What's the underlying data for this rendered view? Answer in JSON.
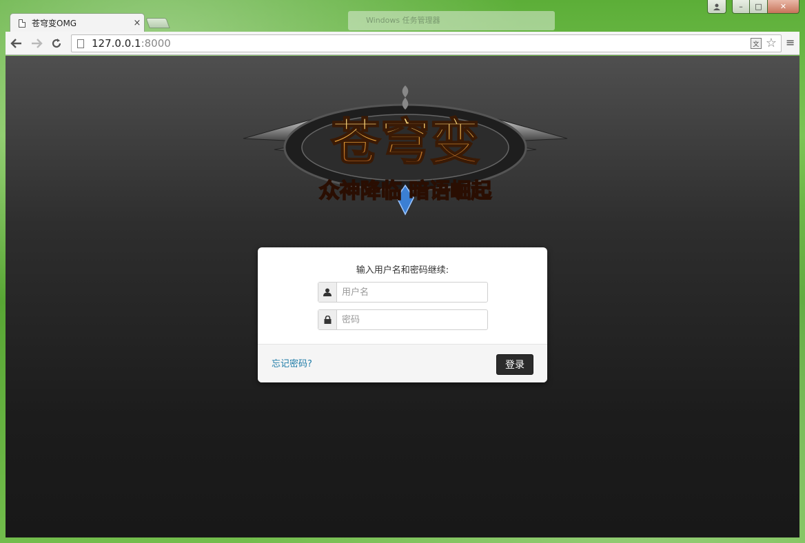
{
  "browser": {
    "tab_title": "苍穹变OMG",
    "url_host": "127.0.0.1",
    "url_port": ":8000",
    "background_window_title": "Windows 任务管理器"
  },
  "window_controls": {
    "minimize": "–",
    "maximize": "□",
    "close": "✕"
  },
  "logo": {
    "title": "苍穹变",
    "subtitle": "众神降临 暗语崛起"
  },
  "login": {
    "prompt": "输入用户名和密码继续:",
    "username_placeholder": "用户名",
    "password_placeholder": "密码",
    "forgot_password": "忘记密码?",
    "submit": "登录"
  },
  "colors": {
    "link": "#1f7ca8",
    "button_bg": "#2b2b2b",
    "logo_gold": "#e8a33a"
  },
  "icons": [
    "back-arrow-icon",
    "forward-arrow-icon",
    "reload-icon",
    "page-icon",
    "translate-icon",
    "star-icon",
    "menu-icon",
    "user-icon",
    "lock-icon"
  ]
}
